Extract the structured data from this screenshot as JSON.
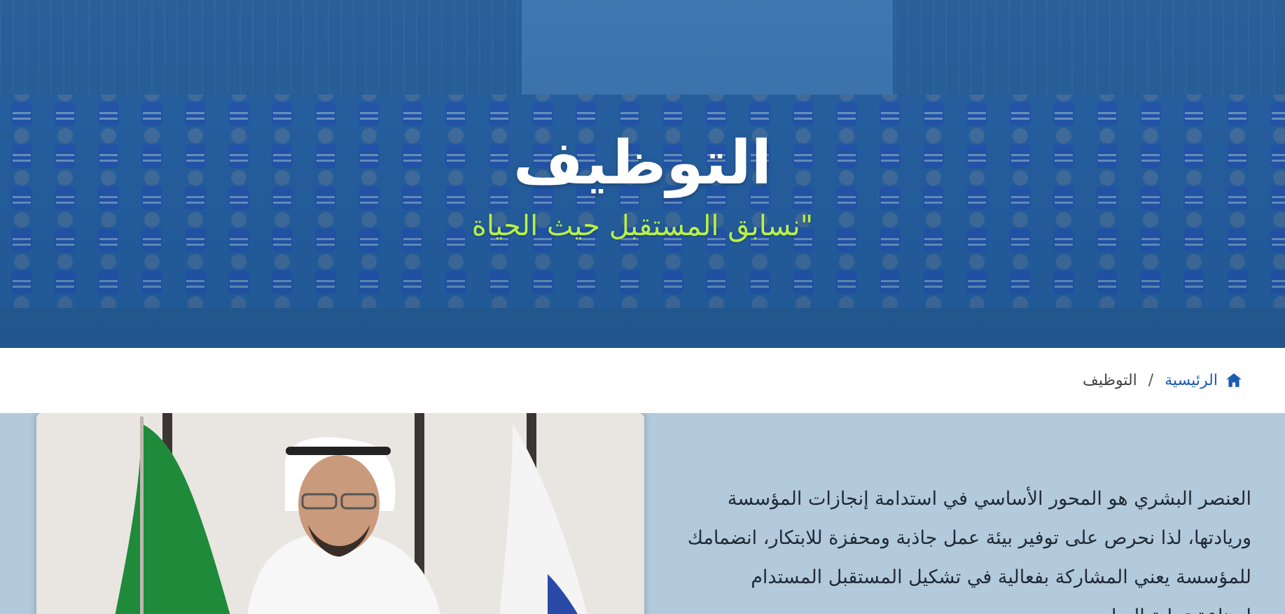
{
  "hero": {
    "title": "التوظيف",
    "subtitle": "\"نسابق المستقبل حيث الحياة"
  },
  "breadcrumb": {
    "home_label": "الرئيسية",
    "separator": "/",
    "current": "التوظيف",
    "home_icon": "home-icon"
  },
  "intro": {
    "lines": [
      "العنصر البشري هو المحور الأساسي في استدامة إنجازات المؤسسة",
      "وريادتها، لذا نحرص على توفير بيئة عمل جاذبة ومحفزة للابتكار، انضمامك",
      "للمؤسسة يعني المشاركة بفعالية في تشكيل المستقبل المستدام",
      "لصناعة تحلية المياه"
    ]
  },
  "colors": {
    "hero_overlay": "#2f6aa6",
    "subtitle": "#b8f04a",
    "link": "#1c5db3",
    "content_bg": "#b3cadc"
  }
}
